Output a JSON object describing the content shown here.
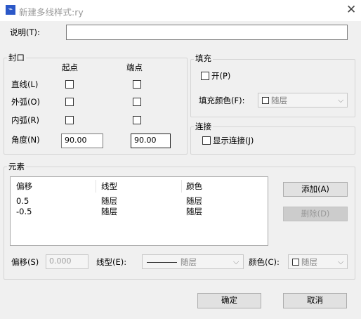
{
  "window": {
    "title": "新建多线样式:ry",
    "icon": "app-logo-icon",
    "close_icon": "close-icon"
  },
  "description": {
    "label": "说明(T):",
    "value": ""
  },
  "caps": {
    "legend": "封口",
    "start_header": "起点",
    "end_header": "端点",
    "rows": [
      {
        "label": "直线(L)",
        "start_checked": false,
        "end_checked": false
      },
      {
        "label": "外弧(O)",
        "start_checked": false,
        "end_checked": false
      },
      {
        "label": "内弧(R)",
        "start_checked": false,
        "end_checked": false
      }
    ],
    "angle": {
      "label": "角度(N)",
      "start": "90.00",
      "end": "90.00"
    }
  },
  "fill": {
    "legend": "填充",
    "on_label": "开(P)",
    "on_checked": false,
    "color_label": "填充颜色(F):",
    "color_value": "随层"
  },
  "connect": {
    "legend": "连接",
    "show_label": "显示连接(J)",
    "show_checked": false
  },
  "elements": {
    "legend": "元素",
    "columns": [
      "偏移",
      "线型",
      "颜色"
    ],
    "rows": [
      [
        "0.5",
        "随层",
        "随层"
      ],
      [
        "-0.5",
        "随层",
        "随层"
      ]
    ],
    "add_button": "添加(A)",
    "delete_button": "删除(D)",
    "offset_label": "偏移(S)",
    "offset_value": "0.000",
    "linetype_label": "线型(E):",
    "linetype_value": "随层",
    "color_label": "颜色(C):",
    "color_value": "随层"
  },
  "buttons": {
    "ok": "确定",
    "cancel": "取消"
  },
  "colors": {
    "title_text": "#999999",
    "logo": "#2b58c8",
    "disabled_text": "#a0a0a0"
  }
}
